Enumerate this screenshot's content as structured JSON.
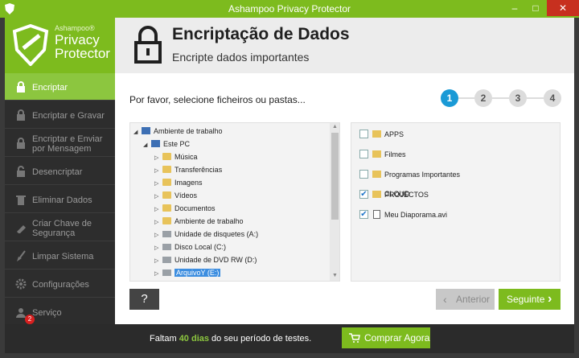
{
  "window": {
    "title": "Ashampoo Privacy Protector",
    "min": "–",
    "max": "□",
    "close": "✕"
  },
  "logo": {
    "small": "Ashampoo®",
    "line1": "Privacy",
    "line2": "Protector"
  },
  "sidebar": {
    "items": [
      {
        "label": "Encriptar",
        "icon": "lock-icon",
        "active": true
      },
      {
        "label": "Encriptar e Gravar",
        "icon": "lock-icon"
      },
      {
        "label": "Encriptar e Enviar por Mensagem",
        "icon": "lock-mail-icon"
      },
      {
        "label": "Desencriptar",
        "icon": "unlock-icon"
      },
      {
        "label": "Eliminar Dados",
        "icon": "trash-icon"
      },
      {
        "label": "Criar Chave de Segurança",
        "icon": "usb-key-icon"
      },
      {
        "label": "Limpar Sistema",
        "icon": "broom-icon"
      },
      {
        "label": "Configurações",
        "icon": "gear-icon"
      },
      {
        "label": "Serviço",
        "icon": "support-icon",
        "badge": "2"
      }
    ]
  },
  "header": {
    "title": "Encriptação de Dados",
    "subtitle": "Encripte dados importantes",
    "icon": "padlock-icon"
  },
  "main": {
    "prompt": "Por favor, selecione ficheiros ou pastas...",
    "steps": [
      "1",
      "2",
      "3",
      "4"
    ],
    "active_step": "1",
    "tree": [
      {
        "label": "Ambiente de trabalho",
        "level": 0,
        "expanded": true,
        "icon": "desktop-icon"
      },
      {
        "label": "Este PC",
        "level": 1,
        "expanded": true,
        "icon": "pc-icon"
      },
      {
        "label": "Música",
        "level": 2,
        "icon": "folder-icon"
      },
      {
        "label": "Transferências",
        "level": 2,
        "icon": "folder-icon"
      },
      {
        "label": "Imagens",
        "level": 2,
        "icon": "folder-icon"
      },
      {
        "label": "Vídeos",
        "level": 2,
        "icon": "folder-icon"
      },
      {
        "label": "Documentos",
        "level": 2,
        "icon": "folder-icon"
      },
      {
        "label": "Ambiente de trabalho",
        "level": 2,
        "icon": "folder-icon"
      },
      {
        "label": "Unidade de disquetes (A:)",
        "level": 2,
        "icon": "drive-icon"
      },
      {
        "label": "Disco Local (C:)",
        "level": 2,
        "icon": "drive-icon"
      },
      {
        "label": "Unidade de DVD RW (D:)",
        "level": 2,
        "icon": "drive-icon"
      },
      {
        "label": "ArquivoY (E:)",
        "level": 2,
        "icon": "drive-icon",
        "selected": true
      }
    ],
    "files": [
      {
        "label": "APPS",
        "checked": false,
        "type": "folder"
      },
      {
        "label": "Filmes",
        "checked": false,
        "type": "folder"
      },
      {
        "label": "Programas Importantes CLOUD",
        "checked": false,
        "type": "folder"
      },
      {
        "label": "PROJECTOS",
        "checked": true,
        "type": "folder"
      },
      {
        "label": "Meu Diaporama.avi",
        "checked": true,
        "type": "file"
      }
    ],
    "help_label": "?",
    "prev_label": "Anterior",
    "next_label": "Seguinte"
  },
  "footer": {
    "msg_prefix": "Faltam ",
    "msg_days": "40 dias",
    "msg_suffix": " do seu período de testes.",
    "buy_label": "Comprar Agora"
  },
  "colors": {
    "accent": "#7dbb1e",
    "step_active": "#1a9ad6",
    "close": "#c7301f"
  }
}
